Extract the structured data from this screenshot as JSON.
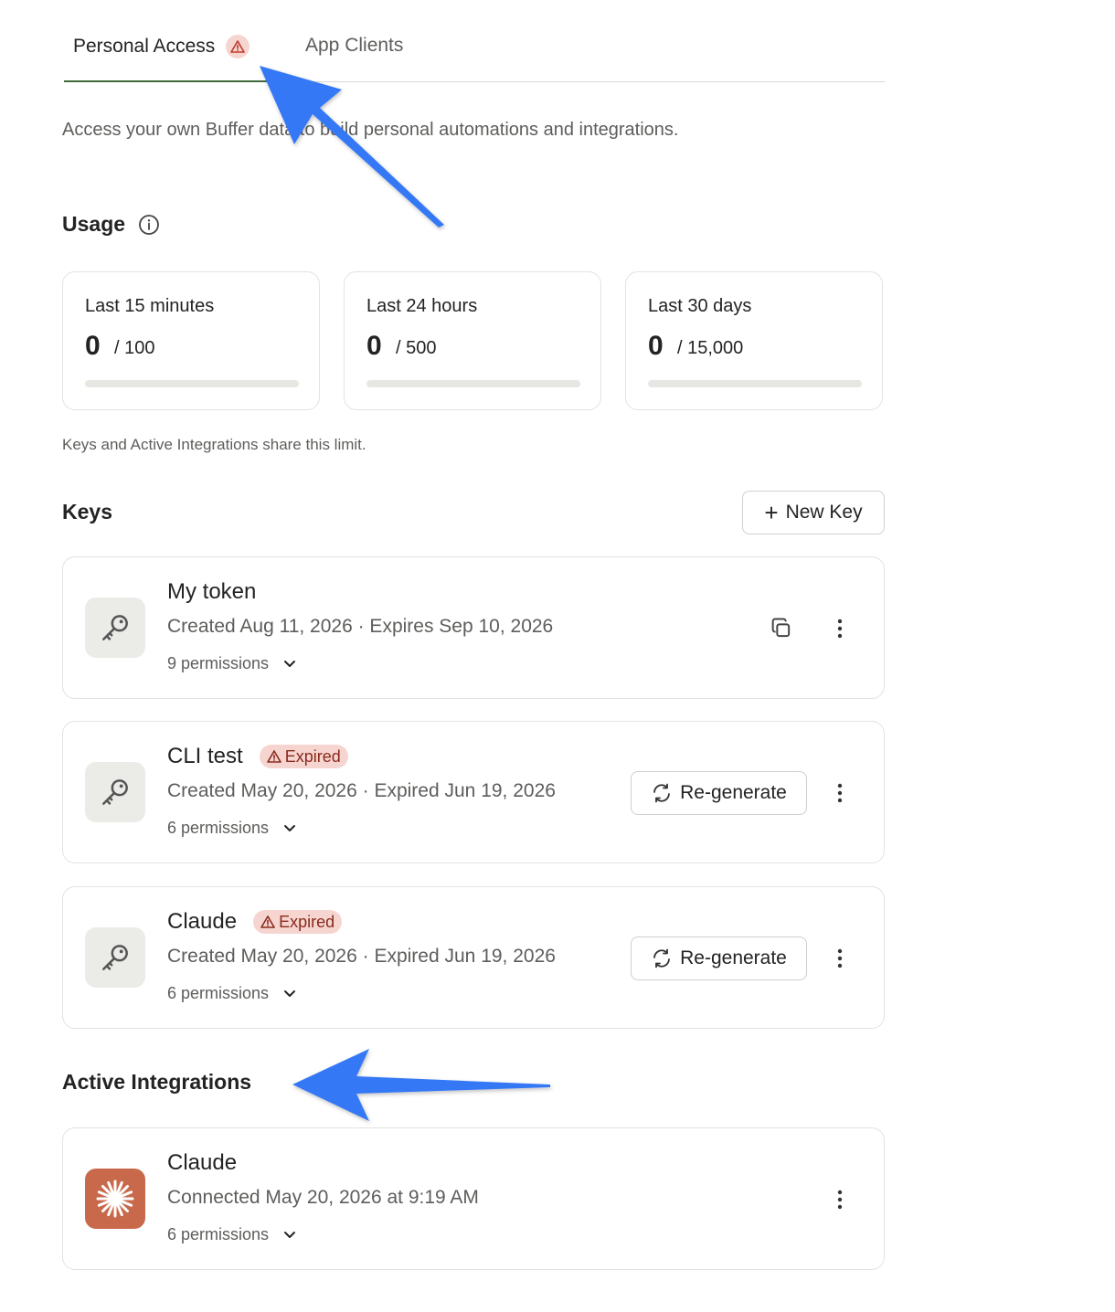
{
  "tabs": [
    {
      "label": "Personal Access",
      "active": true,
      "warning_icon": "warning-triangle-icon"
    },
    {
      "label": "App Clients",
      "active": false
    }
  ],
  "description": "Access your own Buffer data to build personal automations and integrations.",
  "usage": {
    "title": "Usage",
    "cards": [
      {
        "label": "Last 15 minutes",
        "used": "0",
        "limit": "/ 100",
        "fraction": 0
      },
      {
        "label": "Last 24 hours",
        "used": "0",
        "limit": "/ 500",
        "fraction": 0
      },
      {
        "label": "Last 30 days",
        "used": "0",
        "limit": "/ 15,000",
        "fraction": 0
      }
    ],
    "note": "Keys and Active Integrations share this limit."
  },
  "keys": {
    "title": "Keys",
    "new_key_label": "New Key",
    "items": [
      {
        "name": "My token",
        "meta": "Created Aug 11, 2026 · Expires Sep 10, 2026",
        "permissions": "9 permissions"
      },
      {
        "name": "CLI test",
        "badge": "Expired",
        "meta": "Created May 20, 2026 · Expired Jun 19, 2026",
        "permissions": "6 permissions",
        "action": "Re-generate"
      },
      {
        "name": "Claude",
        "badge": "Expired",
        "meta": "Created May 20, 2026 · Expired Jun 19, 2026",
        "permissions": "6 permissions",
        "action": "Re-generate"
      }
    ]
  },
  "integrations": {
    "title": "Active Integrations",
    "items": [
      {
        "name": "Claude",
        "meta": "Connected May 20, 2026 at 9:19 AM",
        "permissions": "6 permissions"
      }
    ]
  },
  "colors": {
    "accent": "#3f6b3c",
    "warning_bg": "#f6d5d0",
    "warning_text": "#8a2a1d",
    "claude_brand": "#c9694b",
    "annotation_arrow": "#3478f6"
  }
}
